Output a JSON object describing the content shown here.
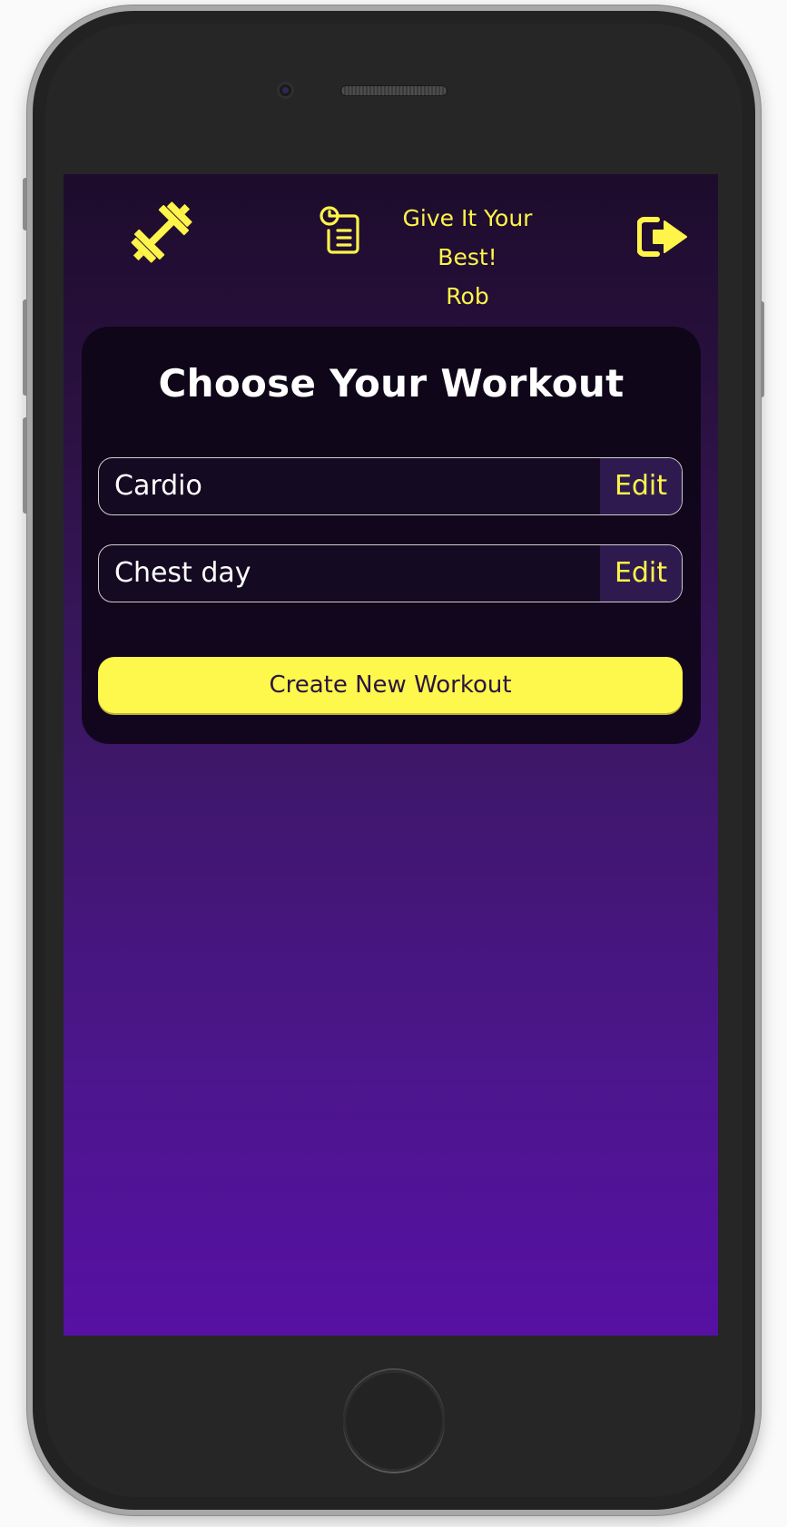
{
  "header": {
    "greeting": "Give It Your Best!",
    "username": "Rob",
    "icons": {
      "logo": "dumbbell-icon",
      "history": "clipboard-clock-icon",
      "logout": "sign-out-icon"
    },
    "accent_color": "#fef44a"
  },
  "main": {
    "title": "Choose Your Workout",
    "workouts": [
      {
        "name": "Cardio",
        "edit_label": "Edit"
      },
      {
        "name": "Chest day",
        "edit_label": "Edit"
      }
    ],
    "create_label": "Create New Workout"
  },
  "colors": {
    "background_top": "#1d0c2c",
    "background_bottom": "#5710a3",
    "button_yellow": "#fdf84b",
    "edit_bg": "#2f1a4f"
  }
}
